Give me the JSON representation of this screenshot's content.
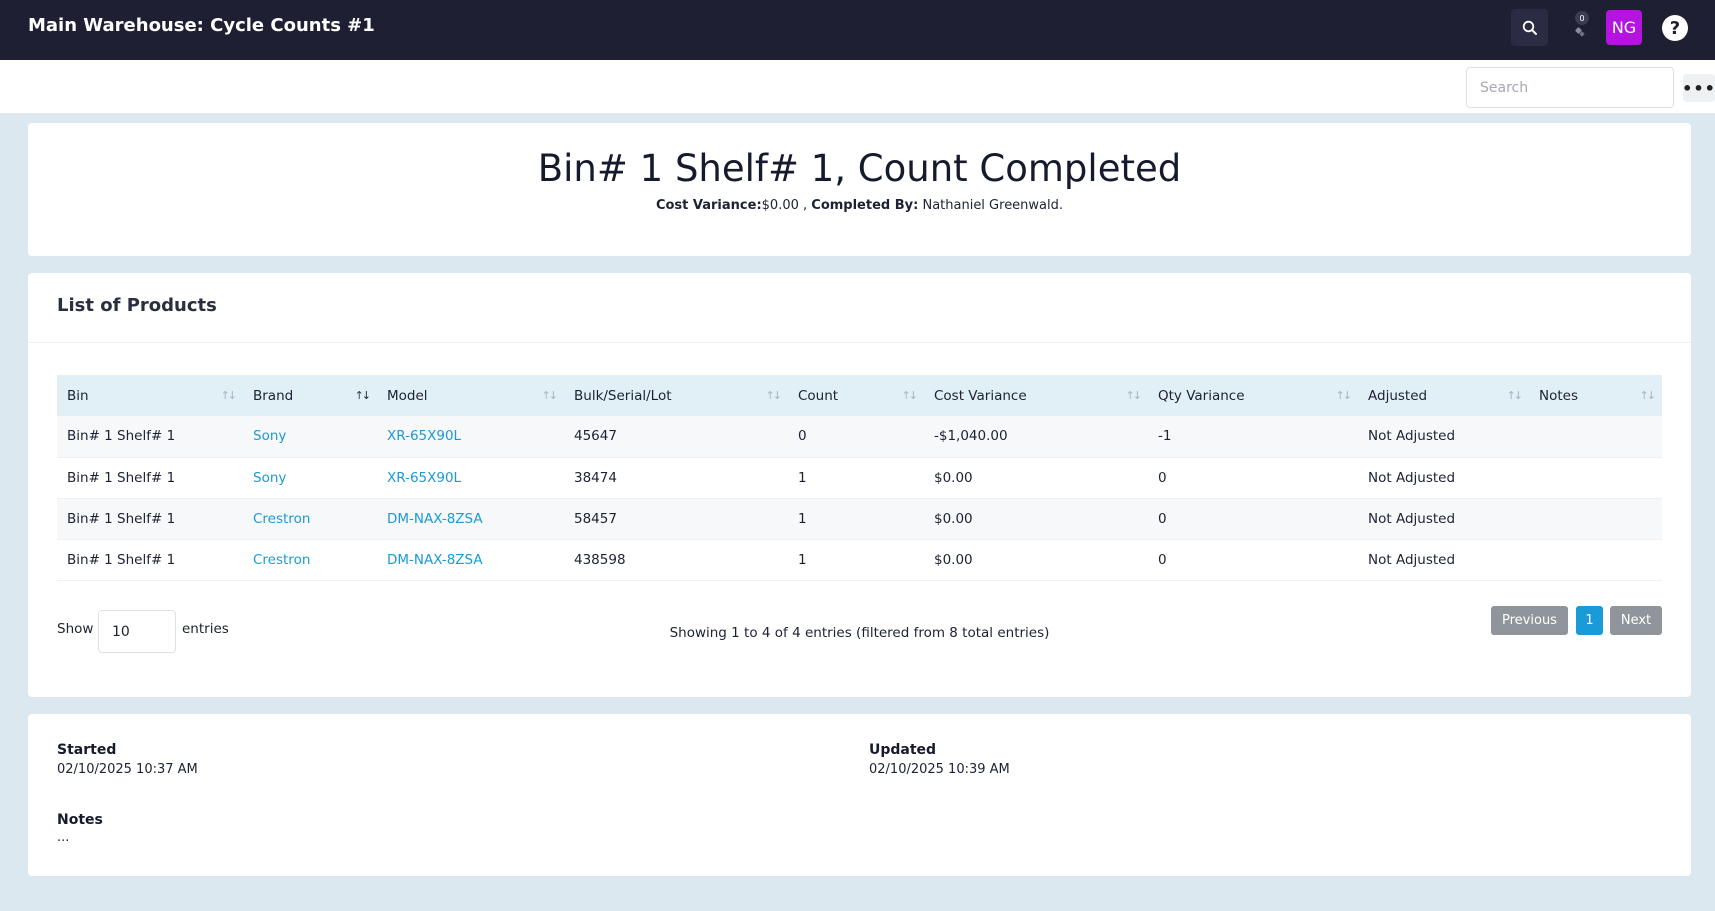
{
  "header": {
    "title": "Main Warehouse: Cycle Counts #1",
    "notification_count": "0",
    "avatar_initials": "NG",
    "help_glyph": "?"
  },
  "toolbar": {
    "search_placeholder": "Search",
    "more_glyph": "•••"
  },
  "summary": {
    "title": "Bin# 1 Shelf# 1, Count Completed",
    "cost_variance_label": "Cost Variance:",
    "cost_variance_value": "$0.00 ,",
    "completed_by_label": "Completed By:",
    "completed_by_value": "Nathaniel Greenwald."
  },
  "products": {
    "heading": "List of Products",
    "columns": [
      "Bin",
      "Brand",
      "Model",
      "Bulk/Serial/Lot",
      "Count",
      "Cost Variance",
      "Qty Variance",
      "Adjusted",
      "Notes"
    ],
    "rows": [
      {
        "bin": "Bin# 1 Shelf# 1",
        "brand": "Sony",
        "model": "XR-65X90L",
        "lot": "45647",
        "count": "0",
        "cost_variance": "-$1,040.00",
        "qty_variance": "-1",
        "adjusted": "Not Adjusted",
        "notes": ""
      },
      {
        "bin": "Bin# 1 Shelf# 1",
        "brand": "Sony",
        "model": "XR-65X90L",
        "lot": "38474",
        "count": "1",
        "cost_variance": "$0.00",
        "qty_variance": "0",
        "adjusted": "Not Adjusted",
        "notes": ""
      },
      {
        "bin": "Bin# 1 Shelf# 1",
        "brand": "Crestron",
        "model": "DM-NAX-8ZSA",
        "lot": "58457",
        "count": "1",
        "cost_variance": "$0.00",
        "qty_variance": "0",
        "adjusted": "Not Adjusted",
        "notes": ""
      },
      {
        "bin": "Bin# 1 Shelf# 1",
        "brand": "Crestron",
        "model": "DM-NAX-8ZSA",
        "lot": "438598",
        "count": "1",
        "cost_variance": "$0.00",
        "qty_variance": "0",
        "adjusted": "Not Adjusted",
        "notes": ""
      }
    ],
    "show_label": "Show",
    "page_size": "10",
    "entries_label": "entries",
    "info": "Showing 1 to 4 of 4 entries (filtered from 8 total entries)",
    "pagination": {
      "previous": "Previous",
      "current_page": "1",
      "next": "Next"
    }
  },
  "meta": {
    "started_label": "Started",
    "started_value": "02/10/2025 10:37 AM",
    "updated_label": "Updated",
    "updated_value": "02/10/2025 10:39 AM",
    "notes_label": "Notes",
    "notes_value": "..."
  },
  "colors": {
    "topbar": "#1f1f33",
    "accent_link": "#1a9ad6",
    "avatar": "#b514e0",
    "table_header": "#e1eff7",
    "page_bg": "#dce8ef"
  }
}
